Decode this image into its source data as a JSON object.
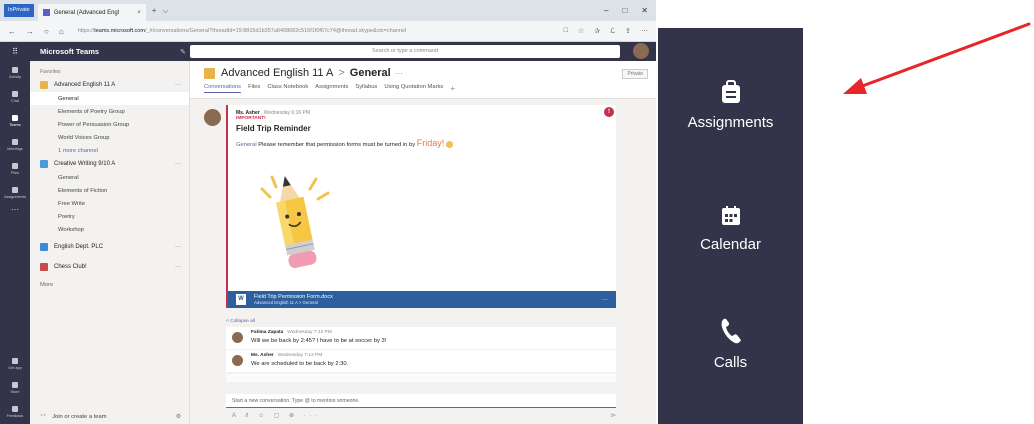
{
  "browser": {
    "inprivate_label": "InPrivate",
    "tab_title": "General (Advanced Engl",
    "tab_close": "×",
    "new_tab": "+",
    "tab_list": "⌵",
    "url_prefix": "https://",
    "url_domain": "teams.microsoft.com",
    "url_rest": "/_#/conversations/General?threadId=19:8815d1b357a8408682c516f1f0f67c74@thread.skype&ctx=channel",
    "nav": [
      "←",
      "→",
      "○",
      "⌂"
    ],
    "win_controls": [
      "–",
      "□",
      "✕"
    ],
    "tools": [
      "□",
      "☆",
      "✰",
      "ℒ",
      "⇪",
      "⋯"
    ]
  },
  "teams_header": {
    "app_name": "Microsoft Teams",
    "search_placeholder": "Search or type a command"
  },
  "rail": {
    "items": [
      {
        "label": "Activity",
        "icon": "bell-icon"
      },
      {
        "label": "Chat",
        "icon": "chat-icon"
      },
      {
        "label": "Teams",
        "icon": "teams-icon",
        "active": true
      },
      {
        "label": "Meetings",
        "icon": "calendar-icon"
      },
      {
        "label": "Files",
        "icon": "files-icon"
      },
      {
        "label": "Assignments",
        "icon": "assignments-icon"
      }
    ],
    "more": "···",
    "bottom": [
      {
        "label": "Get app",
        "icon": "download-icon"
      },
      {
        "label": "Store",
        "icon": "store-icon"
      },
      {
        "label": "Feedback",
        "icon": "feedback-icon"
      }
    ]
  },
  "teamlist": {
    "favorites_label": "Favorites",
    "teams": [
      {
        "name": "Advanced English 11 A",
        "color": "#e8b34a",
        "channels": [
          "General",
          "Elements of Poetry Group",
          "Power of Persuasion Group",
          "World Voices Group"
        ],
        "more": "1 more channel"
      },
      {
        "name": "Creative Writing 9/10 A",
        "color": "#4a9bd6",
        "channels": [
          "General",
          "Elements of Fiction",
          "Free Write",
          "Poetry",
          "Workshop"
        ]
      },
      {
        "name": "English Dept. PLC",
        "color": "#3d8ad6",
        "channels": []
      },
      {
        "name": "Chess Club!",
        "color": "#c84a4a",
        "channels": []
      }
    ],
    "more_label": "More",
    "join_label": "Join or create a team"
  },
  "channel": {
    "team": "Advanced English 11 A",
    "name": "General",
    "dots": "···",
    "private": "Private",
    "tabs": [
      "Conversations",
      "Files",
      "Class Notebook",
      "Assignments",
      "Syllabus",
      "Using Quotation Marks"
    ],
    "add_tab": "+"
  },
  "post": {
    "author": "Ms. Asher",
    "time": "Wednesday 6:16 PM",
    "importance": "IMPORTANT!",
    "subject": "Field Trip Reminder",
    "mention": "General",
    "text": " Please remember that permission forms must be turned in by ",
    "highlight": "Friday!",
    "alert": "!",
    "file_name": "Field Trip Permission Form.docx",
    "file_path": "Advanced English 11 A > General",
    "file_icon": "W",
    "file_dots": "···"
  },
  "collapse_label": "Collapse all",
  "replies": [
    {
      "author": "Fatima Zapata",
      "time": "Wednesday 7:12 PM",
      "text": "Will we be back by 2:45? I have to be at soccer by 3!"
    },
    {
      "author": "Ms. Asher",
      "time": "Wednesday 7:13 PM",
      "text": "We are scheduled to be back by 2:30."
    }
  ],
  "compose": {
    "placeholder": "Start a new conversation. Type @ to mention someone.",
    "tools": "A ∂ ☺ ▢ ⊕ ···",
    "send": "⊳"
  },
  "zoom_panel": {
    "items": [
      {
        "label": "Assignments",
        "icon": "assignments-icon"
      },
      {
        "label": "Calendar",
        "icon": "calendar-icon"
      },
      {
        "label": "Calls",
        "icon": "phone-icon"
      }
    ]
  },
  "colors": {
    "rail": "#33344a",
    "accent": "#6264a7",
    "arrow": "#e8262a",
    "urgent": "#c4314b"
  }
}
